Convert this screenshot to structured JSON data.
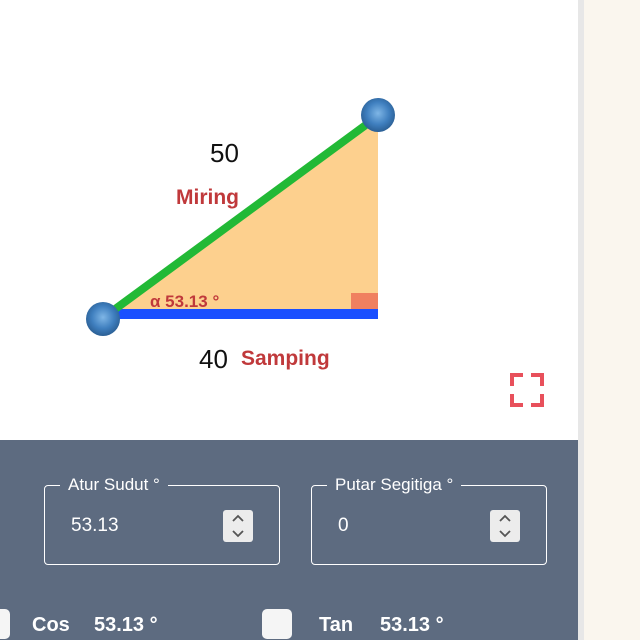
{
  "triangle": {
    "hypotenuse_value": "50",
    "hypotenuse_name": "Miring",
    "adjacent_value": "40",
    "adjacent_name": "Samping",
    "angle_label": "α 53.13 °",
    "colors": {
      "hypotenuse": "#22b936",
      "adjacent": "#1a4fff",
      "fill": "#fdd08e",
      "right_angle_marker": "#f08060",
      "handle": "#4b88c4",
      "label_red": "#c0393b"
    }
  },
  "fullscreen_icon": "expand-icon",
  "controls": {
    "angle": {
      "label": "Atur Sudut °",
      "value": "53.13"
    },
    "rotate": {
      "label": "Putar Segitiga °",
      "value": "0"
    }
  },
  "functions": {
    "cos": {
      "name": "Cos",
      "value": "53.13 °",
      "checked": false
    },
    "tan": {
      "name": "Tan",
      "value": "53.13 °",
      "checked": false
    }
  },
  "panel_color": "#5d6b80"
}
